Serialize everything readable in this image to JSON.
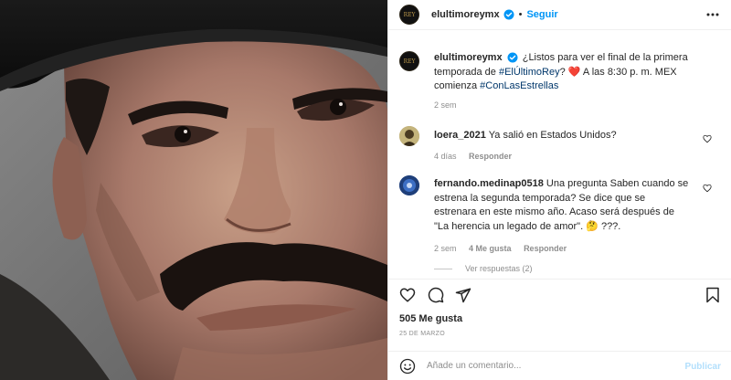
{
  "header": {
    "username": "elultimoreymx",
    "separator": "•",
    "follow_label": "Seguir",
    "avatar_text": "REY"
  },
  "caption": {
    "username": "elultimoreymx",
    "text_1": "¿Listos para ver el final de la primera temporada de",
    "hashtag_1": "#ElÚltimoRey",
    "text_2": "? ❤️ A las 8:30 p. m. MEX comienza",
    "hashtag_2": "#ConLasEstrellas",
    "time": "2 sem"
  },
  "comments": [
    {
      "username": "loera_2021",
      "text": "Ya salió en Estados Unidos?",
      "time": "4 días",
      "reply_label": "Responder"
    },
    {
      "username": "fernando.medinap0518",
      "text": "Una pregunta Saben cuando se estrena la segunda temporada? Se dice que se estrenara en este mismo año. Acaso será después de \"La herencia un legado de amor\". 🤔 ???.",
      "time": "2 sem",
      "likes": "4 Me gusta",
      "reply_label": "Responder",
      "view_replies": "Ver respuestas (2)"
    }
  ],
  "likes_count": "505 Me gusta",
  "post_date": "25 DE MARZO",
  "comment_input": {
    "placeholder": "Añade un comentario...",
    "publish_label": "Publicar"
  },
  "colors": {
    "accent": "#0095f6",
    "hashtag": "#00376b",
    "muted": "#8e8e8e",
    "heart": "#ed4956"
  }
}
